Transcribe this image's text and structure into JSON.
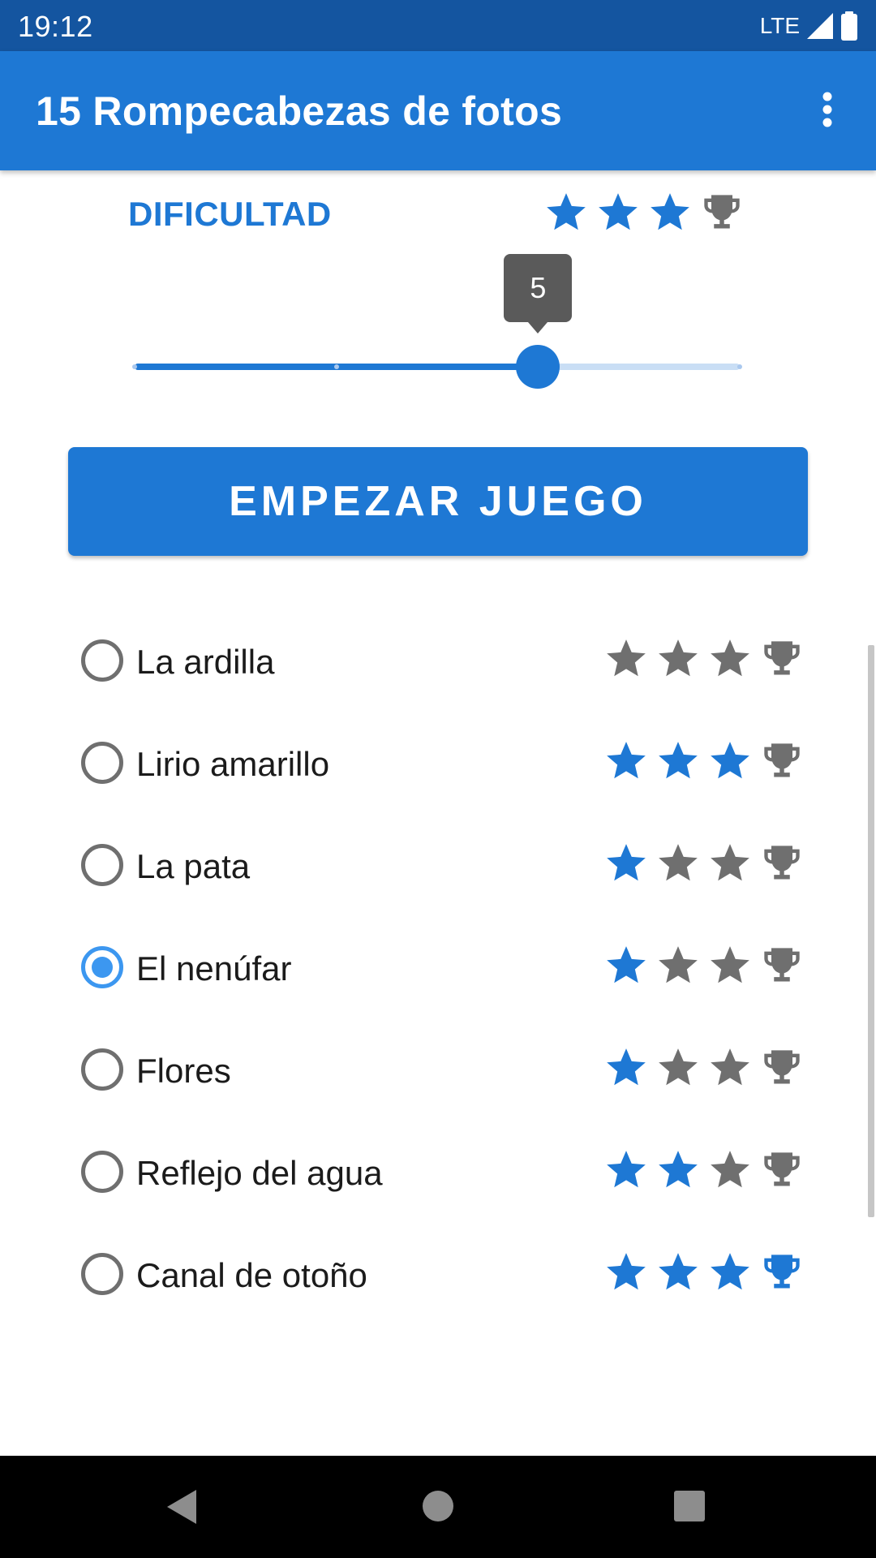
{
  "status_bar": {
    "time": "19:12",
    "network": "LTE",
    "icons": [
      "signal-icon",
      "battery-icon"
    ]
  },
  "app_bar": {
    "title": "15 Rompecabezas de fotos",
    "menu_icon": "more-vert-icon"
  },
  "difficulty": {
    "label": "DIFICULTAD",
    "stars_earned": 3,
    "stars_total": 3,
    "trophy_earned": false,
    "slider": {
      "min": 1,
      "max": 7,
      "value": 5,
      "value_label": "5"
    }
  },
  "start_button": {
    "label": "EMPEZAR JUEGO"
  },
  "puzzles": [
    {
      "label": "La ardilla",
      "selected": false,
      "stars": 0,
      "trophy": false
    },
    {
      "label": "Lirio amarillo",
      "selected": false,
      "stars": 3,
      "trophy": false
    },
    {
      "label": "La pata",
      "selected": false,
      "stars": 1,
      "trophy": false
    },
    {
      "label": "El nenúfar",
      "selected": true,
      "stars": 1,
      "trophy": false
    },
    {
      "label": "Flores",
      "selected": false,
      "stars": 1,
      "trophy": false
    },
    {
      "label": "Reflejo del agua",
      "selected": false,
      "stars": 2,
      "trophy": false
    },
    {
      "label": "Canal de otoño",
      "selected": false,
      "stars": 3,
      "trophy": true
    }
  ],
  "colors": {
    "status_bar": "#1455a0",
    "app_bar": "#1e78d4",
    "accent": "#1e78d4",
    "radio_selected": "#3c97f0",
    "inactive_icon": "#6f6f6f",
    "tooltip": "#5a5a5a"
  },
  "nav_bar": {
    "icons": [
      "back-icon",
      "home-icon",
      "recent-apps-icon"
    ]
  }
}
